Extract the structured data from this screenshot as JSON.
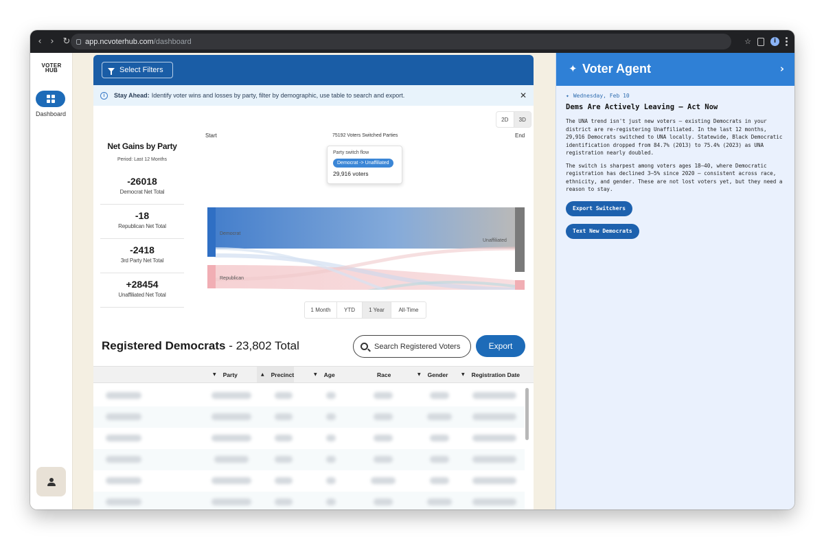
{
  "browser": {
    "back_icon": "‹",
    "forward_icon": "›",
    "reload_icon": "↻",
    "url_host": "app.ncvoterhub.com",
    "url_path": "/dashboard",
    "star_icon": "☆"
  },
  "nav": {
    "logo_line1": "VOTER",
    "logo_line2": "HUB",
    "dashboard_label": "Dashboard"
  },
  "filters": {
    "button_label": "Select Filters"
  },
  "banner": {
    "lead": "Stay Ahead:",
    "text": "Identify voter wins and losses by party, filter by demographic, use table to search and export.",
    "close": "✕"
  },
  "view_toggle": {
    "option_2d": "2D",
    "option_3d": "3D",
    "selected": "3D"
  },
  "gains": {
    "title": "Net Gains by Party",
    "period": "Period: Last 12 Months",
    "stats": [
      {
        "value": "-26018",
        "label": "Democrat Net Total"
      },
      {
        "value": "-18",
        "label": "Republican Net Total"
      },
      {
        "value": "-2418",
        "label": "3rd Party Net Total"
      },
      {
        "value": "+28454",
        "label": "Unaffiliated Net Total"
      }
    ]
  },
  "chart_data": {
    "type": "sankey",
    "start_label": "Start",
    "end_label": "End",
    "title": "75192 Voters Switched Parties",
    "sources": [
      "Democrat",
      "Republican",
      "Unaffiliated",
      "3rd Party"
    ],
    "targets": [
      "Unaffiliated",
      "Republican",
      "Democrat",
      "3rd Party"
    ],
    "flows": [
      {
        "from": "Democrat",
        "to": "Unaffiliated",
        "value": 29916
      }
    ],
    "colors": {
      "Democrat": "#3b78c9",
      "Republican": "#f2b3b8",
      "Unaffiliated": "#b9b9b9",
      "3rd Party": "#a8dbe0"
    },
    "tooltip": {
      "title": "Party switch flow",
      "flow": "Democrat -> Unaffiliated",
      "count": "29,916 voters"
    }
  },
  "time_range": {
    "options": [
      "1 Month",
      "YTD",
      "1 Year",
      "All-Time"
    ],
    "selected": "1 Year"
  },
  "registered": {
    "title": "Registered Democrats",
    "total": "- 23,802 Total",
    "search_placeholder": "Search Registered Voters",
    "export_label": "Export",
    "columns": [
      "Party",
      "Precinct",
      "Age",
      "Race",
      "Gender",
      "Registration Date"
    ],
    "sorted_column": "Precinct"
  },
  "agent": {
    "title": "Voter Agent",
    "date": "Wednesday, Feb 10",
    "headline": "Dems Are Actively Leaving — Act Now",
    "paragraph1": "The UNA trend isn't just new voters — existing Democrats in your district are re-registering Unaffiliated. In the last 12 months, 29,916 Democrats switched to UNA locally. Statewide, Black Democratic identification dropped from 84.7% (2013) to 75.4% (2023) as UNA registration nearly doubled.",
    "paragraph2": "The switch is sharpest among voters ages 18–40, where Democratic registration has declined 3–5% since 2020 — consistent across race, ethnicity, and gender. These are not lost voters yet, but they need a reason to stay.",
    "actions": [
      "Export Switchers",
      "Text New Democrats"
    ]
  }
}
